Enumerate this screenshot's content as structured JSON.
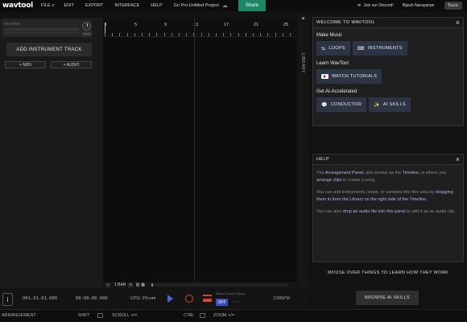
{
  "app": {
    "logo": "wavtool"
  },
  "menu": {
    "file": "FILE ≡",
    "edit": "EDIT",
    "export": "EXPORT",
    "interface": "INTERFACE",
    "help": "HELP",
    "project": "Go Pro:Untitled Project"
  },
  "header": {
    "share": "Share",
    "discord": "Join our Discord!",
    "user": "Bijesh Narayanan",
    "plan": "Basic"
  },
  "left": {
    "master_label": "MASTER",
    "master_button": "MUTE",
    "add_track": "ADD INSTRUMENT TRACK",
    "midi": "+ MIDI",
    "audio": "+ AUDIO"
  },
  "ruler": {
    "bars": [
      "1",
      "5",
      "9",
      "13",
      "17",
      "21",
      "25"
    ]
  },
  "zoombar": {
    "minus": "−",
    "bar": "1 BAR",
    "plus": "+"
  },
  "library": {
    "label": "LIBRARY",
    "arrow": "◀"
  },
  "welcome": {
    "title": "WELCOME TO WAVTOOL",
    "make_music": "Make Music",
    "loops": "LOOPS",
    "instruments": "INSTRUMENTS",
    "learn": "Learn WavTool",
    "tutorials": "WATCH TUTORIALS",
    "ai": "Get AI-Accelerated",
    "conductor": "CONDUCTOR",
    "ai_skills": "AI SKILLS"
  },
  "help": {
    "title": "HELP",
    "p1_a": "The ",
    "p1_b": "Arrangement Panel,",
    "p1_c": " also known as the ",
    "p1_d": "Timeline,",
    "p1_e": " is where you ",
    "p1_f": "arrange clips",
    "p1_g": " to create a song.",
    "p2_a": "You can add instruments, loops, or samples into this area by ",
    "p2_b": "dragging them in from the Library on the right side of the Timeline.",
    "p3_a": "You can also ",
    "p3_b": "drop an audio file into this panel",
    "p3_c": " to add it as an audio clip."
  },
  "mouseover": "MOUSE OVER THINGS TO LEARN HOW THEY WORK",
  "browse": "BROWSE AI SKILLS",
  "transport": {
    "position": "001.01.01.000",
    "time": "00:00:00.000",
    "cpu": "CPU: 2%",
    "record_label": "Record Count-in (Bars)",
    "off": "OFF",
    "count": "1  2  4",
    "bpm": "128BPM"
  },
  "status": {
    "mode": "ARRANGEMENT",
    "shift": "SHIFT",
    "scroll": "SCROLL +/=",
    "ctrl": "CTRL",
    "zoom": "ZOOM +/="
  }
}
